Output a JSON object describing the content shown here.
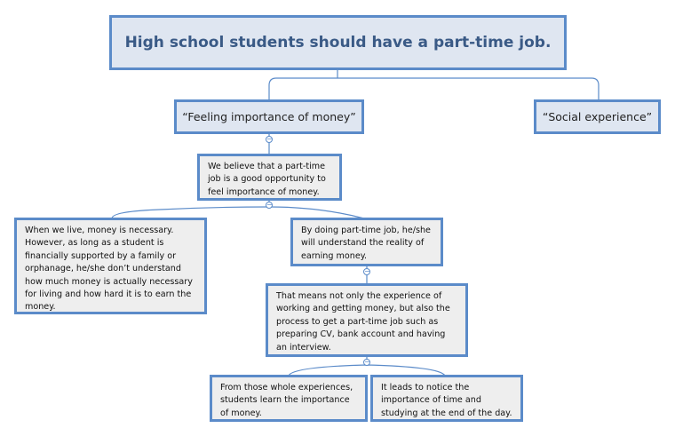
{
  "root": {
    "title": "High school students should have a part-time job."
  },
  "branches": {
    "feeling": "“Feeling importance of money”",
    "social": "“Social experience”"
  },
  "nodes": {
    "believe": "We believe that a part-time job is a good opportunity to feel importance of money.",
    "live": "When we live, money is necessary. However, as long as a student is financially supported by a family or orphanage, he/she don’t understand how much money is actually necessary for living and how hard it is to earn the money.",
    "doing": "By doing part-time job, he/she will understand the reality of earning money.",
    "means": "That means not only the experience of working and getting money, but also the process to get a part-time job such as preparing CV, bank account and having an interview.",
    "whole": "From those whole experiences, students learn the importance of money.",
    "leads": "It leads to notice the importance of time and studying at the end of the day."
  },
  "collapse_symbol": "−",
  "colors": {
    "border": "#5b8bc9",
    "title_fill": "#dfe6f1",
    "leaf_fill": "#eeeeee",
    "title_text": "#3a5a86"
  }
}
